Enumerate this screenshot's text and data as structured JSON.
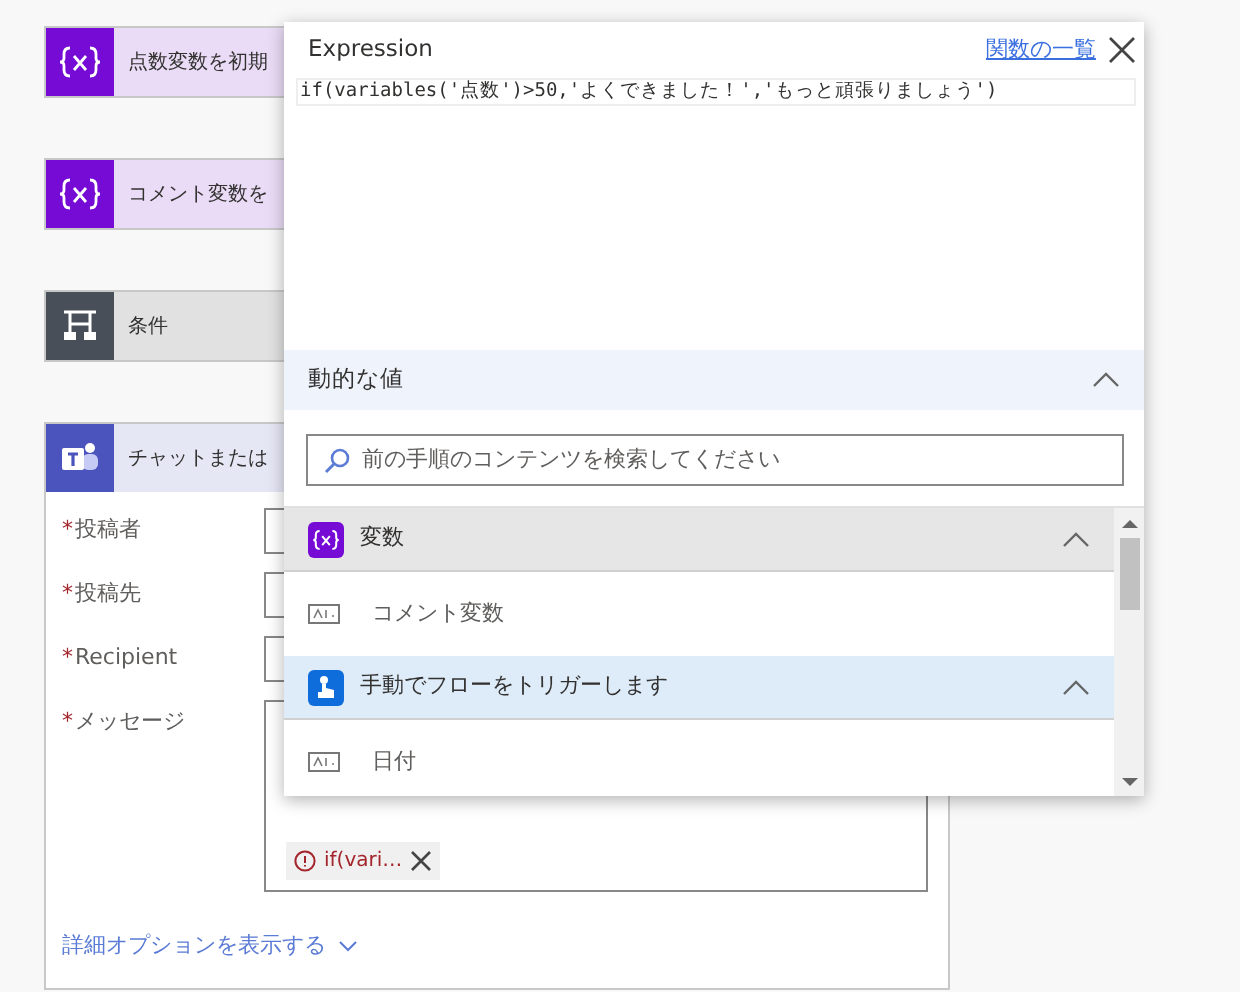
{
  "flow_steps": [
    {
      "kind": "variable",
      "title": "点数変数を初期"
    },
    {
      "kind": "variable",
      "title": "コメント変数を"
    },
    {
      "kind": "condition",
      "title": "条件"
    },
    {
      "kind": "teams",
      "title": "チャットまたは",
      "fields": [
        {
          "label": "投稿者",
          "required_mark": "*",
          "kind": "input"
        },
        {
          "label": "投稿先",
          "required_mark": "*",
          "kind": "input"
        },
        {
          "label": "Recipient",
          "required_mark": "*",
          "kind": "input"
        },
        {
          "label": "メッセージ",
          "required_mark": "*",
          "kind": "editor",
          "token": {
            "text": "if(vari…",
            "error": true
          }
        }
      ],
      "advanced_link": "詳細オプションを表示する"
    }
  ],
  "expression_panel": {
    "title": "Expression",
    "functions_link": "関数の一覧",
    "expression": "if(variables('点数')>50,'よくできました！','もっと頑張りましょう')",
    "dynamic": {
      "title": "動的な値",
      "expanded": true,
      "search_placeholder": "前の手順のコンテンツを検索してください",
      "groups": [
        {
          "kind": "variable",
          "title": "変数",
          "expanded": true,
          "selected": false,
          "items": [
            "コメント変数"
          ]
        },
        {
          "kind": "trigger",
          "title": "手動でフローをトリガーします",
          "expanded": true,
          "selected": true,
          "items": [
            "日付"
          ]
        }
      ]
    }
  }
}
